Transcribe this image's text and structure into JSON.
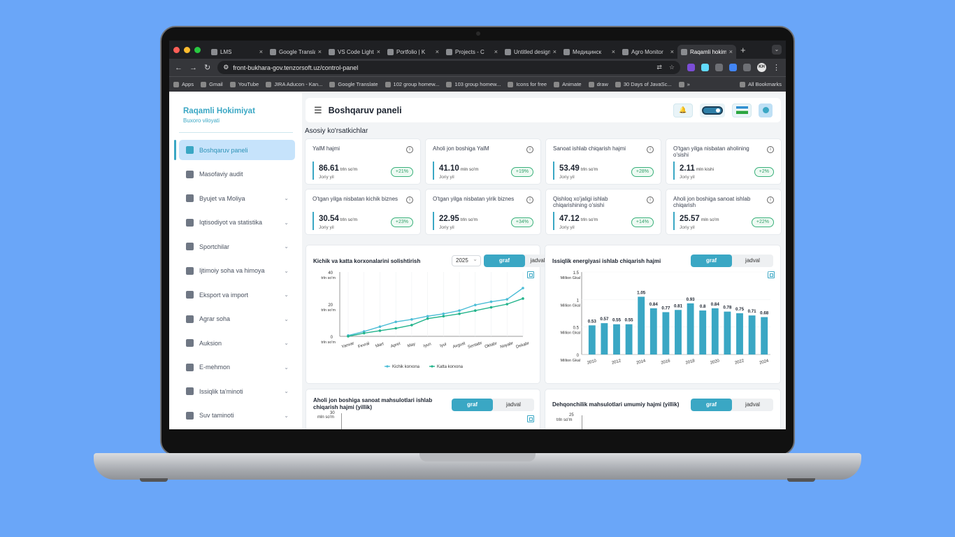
{
  "browser": {
    "tabs": [
      {
        "title": "LMS",
        "active": false
      },
      {
        "title": "Google Translate",
        "active": false
      },
      {
        "title": "VS Code Light",
        "active": false
      },
      {
        "title": "Portfolio | K",
        "active": false
      },
      {
        "title": "Projects - C",
        "active": false
      },
      {
        "title": "Untitled design",
        "active": false
      },
      {
        "title": "Медицинск",
        "active": false
      },
      {
        "title": "Agro Monitor",
        "active": false
      },
      {
        "title": "Raqamli hokimiyat",
        "active": true
      }
    ],
    "url": "front-bukhara-gov.tenzorsoft.uz/control-panel",
    "profile_initials": "KH",
    "bookmarks": [
      "Apps",
      "Gmail",
      "YouTube",
      "JIRA Aducon - Kan...",
      "Google Translate",
      "102 group homew...",
      "103 group homew...",
      "Icons for free",
      "Animate",
      "draw",
      "30 Days of JavaSc...",
      "»"
    ],
    "all_bookmarks": "All Bookmarks"
  },
  "sidebar": {
    "brand_title": "Raqamli Hokimiyat",
    "brand_subtitle": "Buxoro viloyati",
    "items": [
      {
        "label": "Boshqaruv paneli",
        "icon": "dashboard-icon",
        "active": true,
        "chevron": false
      },
      {
        "label": "Masofaviy audit",
        "icon": "clipboard-icon",
        "active": false,
        "chevron": false
      },
      {
        "label": "Byujet va Moliya",
        "icon": "pie-chart-icon",
        "active": false,
        "chevron": true
      },
      {
        "label": "Iqtisodiyot va statistika",
        "icon": "chart-icon",
        "active": false,
        "chevron": true
      },
      {
        "label": "Sportchilar",
        "icon": "trophy-icon",
        "active": false,
        "chevron": true
      },
      {
        "label": "Ijtimoiy soha va himoya",
        "icon": "people-icon",
        "active": false,
        "chevron": true
      },
      {
        "label": "Eksport va import",
        "icon": "transfer-icon",
        "active": false,
        "chevron": true
      },
      {
        "label": "Agrar soha",
        "icon": "tractor-icon",
        "active": false,
        "chevron": true
      },
      {
        "label": "Auksion",
        "icon": "gavel-icon",
        "active": false,
        "chevron": true
      },
      {
        "label": "E-mehmon",
        "icon": "building-icon",
        "active": false,
        "chevron": true
      },
      {
        "label": "Issiqlik ta'minoti",
        "icon": "radiator-icon",
        "active": false,
        "chevron": true
      },
      {
        "label": "Suv taminoti",
        "icon": "water-drop-icon",
        "active": false,
        "chevron": true
      }
    ]
  },
  "header": {
    "title": "Boshqaruv paneli"
  },
  "section_title": "Asosiy ko'rsatkichlar",
  "kpis": [
    {
      "title": "YalM hajmi",
      "value": "86.61",
      "unit": "trln so'm",
      "period": "Joriy yil",
      "change": "+21%"
    },
    {
      "title": "Aholi jon boshiga YalM",
      "value": "41.10",
      "unit": "mln so'm",
      "period": "Joriy yil",
      "change": "+19%"
    },
    {
      "title": "Sanoat ishlab chiqarish hajmi",
      "value": "53.49",
      "unit": "trln so'm",
      "period": "Joriy yil",
      "change": "+28%"
    },
    {
      "title": "O'tgan yilga nisbatan aholining o'sishi",
      "value": "2.11",
      "unit": "mln kishi",
      "period": "Joriy yil",
      "change": "+2%"
    },
    {
      "title": "O'tgan yilga nisbatan kichik biznes",
      "value": "30.54",
      "unit": "trln so'm",
      "period": "Joriy yil",
      "change": "+23%"
    },
    {
      "title": "O'tgan yilga nisbatan yirik biznes",
      "value": "22.95",
      "unit": "trln so'm",
      "period": "Joriy yil",
      "change": "+34%"
    },
    {
      "title": "Qishloq xo'jaligi ishlab chiqarishining o'sishi",
      "value": "47.12",
      "unit": "trln so'm",
      "period": "Joriy yil",
      "change": "+14%"
    },
    {
      "title": "Aholi jon boshiga sanoat ishlab chiqarish",
      "value": "25.57",
      "unit": "mln so'm",
      "period": "Joriy yil",
      "change": "+22%"
    }
  ],
  "toggle": {
    "graph": "graf",
    "table": "jadval"
  },
  "chart1": {
    "title": "Kichik va katta korxonalarini solishtirish",
    "year": "2025"
  },
  "chart2": {
    "title": "Issiqlik energiyasi ishlab chiqarish hajmi"
  },
  "chart3": {
    "title": "Aholi jon boshiga sanoat mahsulotlari ishlab chiqarish hajmi (yillik)",
    "ylabel": "mln so'm",
    "ytop": "30"
  },
  "chart4": {
    "title": "Dehqonchilik mahsulotlari umumiy hajmi (yillik)",
    "ylabel": "trln so'm",
    "ytop": "25"
  },
  "colors": {
    "accent": "#3aa7c4",
    "line1": "#4cbdd6",
    "line2": "#23b48c",
    "positive": "#2f9d67"
  },
  "chart_data": [
    {
      "type": "line",
      "title": "Kichik va katta korxonalarini solishtirish",
      "ylabel": "trln so'm",
      "x": [
        "Yanvar",
        "Fevral",
        "Mart",
        "Aprel",
        "May",
        "Iyun",
        "Iyul",
        "Avgust",
        "Sentabr",
        "Oktabr",
        "Noyabr",
        "Dekabr"
      ],
      "yticks": [
        "40",
        "20",
        "0"
      ],
      "ylim": [
        0,
        40
      ],
      "series": [
        {
          "name": "Kichik korxona",
          "values": [
            0.5,
            3,
            6,
            9,
            10.5,
            12.5,
            14,
            16,
            19.5,
            21.5,
            23,
            30
          ]
        },
        {
          "name": "Katta korxona",
          "values": [
            0,
            2,
            3.5,
            5,
            7,
            11,
            12.5,
            14,
            16,
            18,
            20,
            23.5
          ]
        }
      ],
      "legend": "bottom"
    },
    {
      "type": "bar",
      "title": "Issiqlik energiyasi ishlab chiqarish hajmi",
      "ylabel": "Million Gkal",
      "categories": [
        "2010",
        "2011",
        "2012",
        "2013",
        "2014",
        "2015",
        "2016",
        "2017",
        "2018",
        "2019",
        "2020",
        "2021",
        "2022",
        "2023",
        "2024"
      ],
      "values": [
        0.53,
        0.57,
        0.55,
        0.55,
        1.05,
        0.84,
        0.77,
        0.81,
        0.93,
        0.8,
        0.84,
        0.78,
        0.75,
        0.71,
        0.68
      ],
      "xticks": [
        "2010",
        "2012",
        "2014",
        "2016",
        "2018",
        "2020",
        "2022",
        "2024"
      ],
      "yticks": [
        "1.5",
        "1",
        "0.5",
        "0"
      ],
      "ylim": [
        0,
        1.5
      ]
    }
  ]
}
